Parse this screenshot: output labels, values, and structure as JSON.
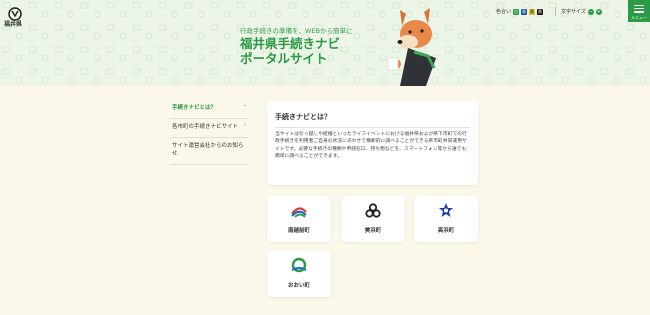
{
  "header": {
    "logo_text": "福井県",
    "tagline": "行政手続きの準備を、WEBから簡単に",
    "title_line1": "福井県手続きナビ",
    "title_line2": "ポータルサイト",
    "color_label": "色合い",
    "color_swatches": [
      "白",
      "青",
      "黄",
      "黒"
    ],
    "font_size_label": "文字サイズ",
    "font_minus": "−",
    "font_plus": "+",
    "menu_label": "メニュー",
    "accent": "#2a9a44"
  },
  "sidebar": {
    "items": [
      {
        "label": "手続きナビとは？",
        "chevron": "˅"
      },
      {
        "label": "各市町の手続きナビサイト",
        "chevron": "˄"
      },
      {
        "label": "サイト運営会社からのお知らせ",
        "chevron": ""
      }
    ]
  },
  "intro": {
    "title": "手続きナビとは？",
    "body": "当サイトは引っ越しや結婚といったライフイベントにおける福井県および県下市町での行政手続きを利用者ご自身の状況にあわせて横断的に調べることができる県市町共同運用サイトです。必要な手続きの種類や申請窓口、持ち物などを、スマートフォン等から誰でも簡単に調べることができます。"
  },
  "towns": [
    {
      "name": "南越前町",
      "icon": "minamiechizen-emblem"
    },
    {
      "name": "美浜町",
      "icon": "mihama-emblem"
    },
    {
      "name": "高浜町",
      "icon": "takahama-emblem"
    },
    {
      "name": "おおい町",
      "icon": "ohi-emblem"
    }
  ]
}
